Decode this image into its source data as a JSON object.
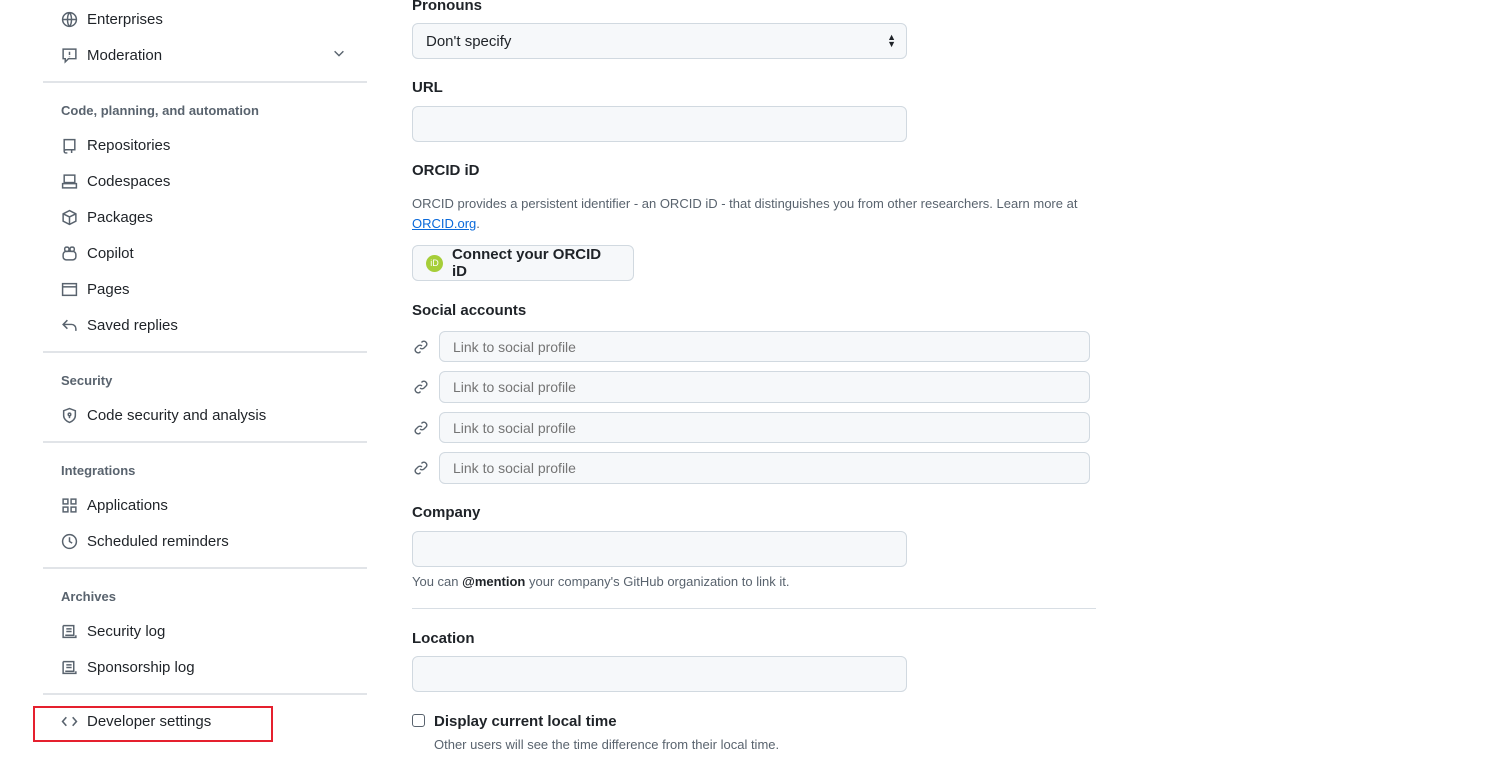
{
  "sidebar": {
    "items": [
      {
        "label": "Enterprises",
        "icon": "globe-icon"
      },
      {
        "label": "Moderation",
        "icon": "report-icon"
      }
    ],
    "sections": [
      {
        "heading": "Code, planning, and automation",
        "items": [
          {
            "label": "Repositories",
            "icon": "repo-icon"
          },
          {
            "label": "Codespaces",
            "icon": "codespaces-icon"
          },
          {
            "label": "Packages",
            "icon": "package-icon"
          },
          {
            "label": "Copilot",
            "icon": "copilot-icon"
          },
          {
            "label": "Pages",
            "icon": "browser-icon"
          },
          {
            "label": "Saved replies",
            "icon": "reply-icon"
          }
        ]
      },
      {
        "heading": "Security",
        "items": [
          {
            "label": "Code security and analysis",
            "icon": "shield-icon"
          }
        ]
      },
      {
        "heading": "Integrations",
        "items": [
          {
            "label": "Applications",
            "icon": "apps-icon"
          },
          {
            "label": "Scheduled reminders",
            "icon": "clock-icon"
          }
        ]
      },
      {
        "heading": "Archives",
        "items": [
          {
            "label": "Security log",
            "icon": "log-icon"
          },
          {
            "label": "Sponsorship log",
            "icon": "log-icon"
          }
        ]
      }
    ],
    "developer": {
      "label": "Developer settings",
      "icon": "code-icon",
      "highlight_color": "#e5202e"
    }
  },
  "form": {
    "pronouns": {
      "label": "Pronouns",
      "value": "Don't specify"
    },
    "url": {
      "label": "URL",
      "value": ""
    },
    "orcid": {
      "label": "ORCID iD",
      "description": "ORCID provides a persistent identifier - an ORCID iD - that distinguishes you from other researchers. Learn more at",
      "link": "ORCID.org",
      "button": "Connect your ORCID iD",
      "badge": "iD"
    },
    "social": {
      "label": "Social accounts",
      "placeholder": "Link to social profile"
    },
    "company": {
      "label": "Company",
      "value": "",
      "help_pre": "You can",
      "help_bold": "@mention",
      "help_post": "your company's GitHub organization to link it."
    },
    "location": {
      "label": "Location",
      "value": ""
    },
    "local_time": {
      "label": "Display current local time",
      "checked": false,
      "help": "Other users will see the time difference from their local time."
    }
  }
}
